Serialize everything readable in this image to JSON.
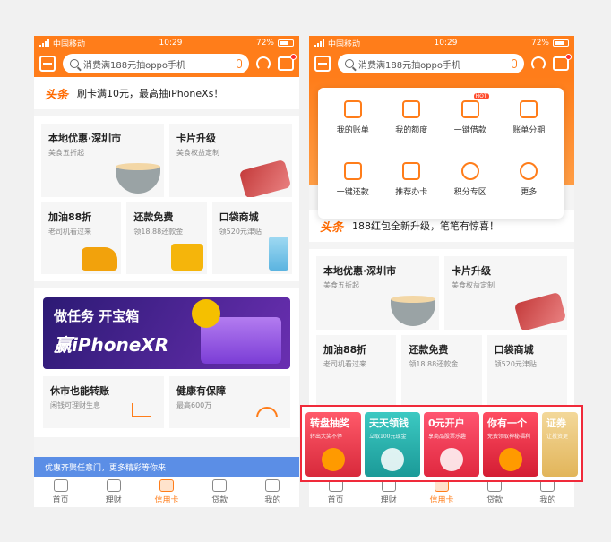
{
  "status": {
    "carrier": "中国移动",
    "time": "10:29",
    "battery": "72%"
  },
  "search": {
    "placeholder": "消费满188元抽oppo手机"
  },
  "news": {
    "brand": "头条",
    "left_text": "刷卡满10元，最高抽iPhoneXs！",
    "right_text": "188红包全新升级，笔笔有惊喜！"
  },
  "tiles": {
    "local": {
      "title": "本地优惠·深圳市",
      "sub": "美食五折起"
    },
    "card_upgrade": {
      "title": "卡片升级",
      "sub": "美食权益定制"
    },
    "fuel": {
      "title": "加油88折",
      "sub": "老司机看过来"
    },
    "repay": {
      "title": "还款免费",
      "sub": "领18.88还款金"
    },
    "mall": {
      "title": "口袋商城",
      "sub": "领520元津贴"
    }
  },
  "promo": {
    "banner_line1": "做任务 开宝箱",
    "banner_line2": "赢iPhoneXR",
    "left": {
      "title": "休市也能转账",
      "sub": "闲钱可理财生息"
    },
    "right": {
      "title": "健康有保障",
      "sub": "最高600万"
    }
  },
  "notice": "优惠齐聚任意门，更多精彩等你来",
  "tabs": [
    "首页",
    "理财",
    "信用卡",
    "贷款",
    "我的"
  ],
  "quick": [
    {
      "label": "我的账单",
      "icon": "bill-icon"
    },
    {
      "label": "我的额度",
      "icon": "quota-icon"
    },
    {
      "label": "一键借款",
      "icon": "loan-icon",
      "badge": "HOT"
    },
    {
      "label": "账单分期",
      "icon": "calendar-icon"
    },
    {
      "label": "一键还款",
      "icon": "repay-icon"
    },
    {
      "label": "推荐办卡",
      "icon": "gift-icon"
    },
    {
      "label": "积分专区",
      "icon": "points-icon"
    },
    {
      "label": "更多",
      "icon": "more-icon"
    }
  ],
  "carousel": [
    {
      "title": "转盘抽奖",
      "sub": "转出大奖不停"
    },
    {
      "title": "天天领钱",
      "sub": "立取100元现金"
    },
    {
      "title": "0元开户",
      "sub": "享商品股票乐趣"
    },
    {
      "title": "你有一个",
      "sub": "免费领取神秘福利"
    },
    {
      "title": "证券",
      "sub": "让投资更"
    }
  ],
  "colors": {
    "brand": "#ff7d1a",
    "highlight_border": "#f02a3a",
    "notice": "#5b8ee6"
  }
}
